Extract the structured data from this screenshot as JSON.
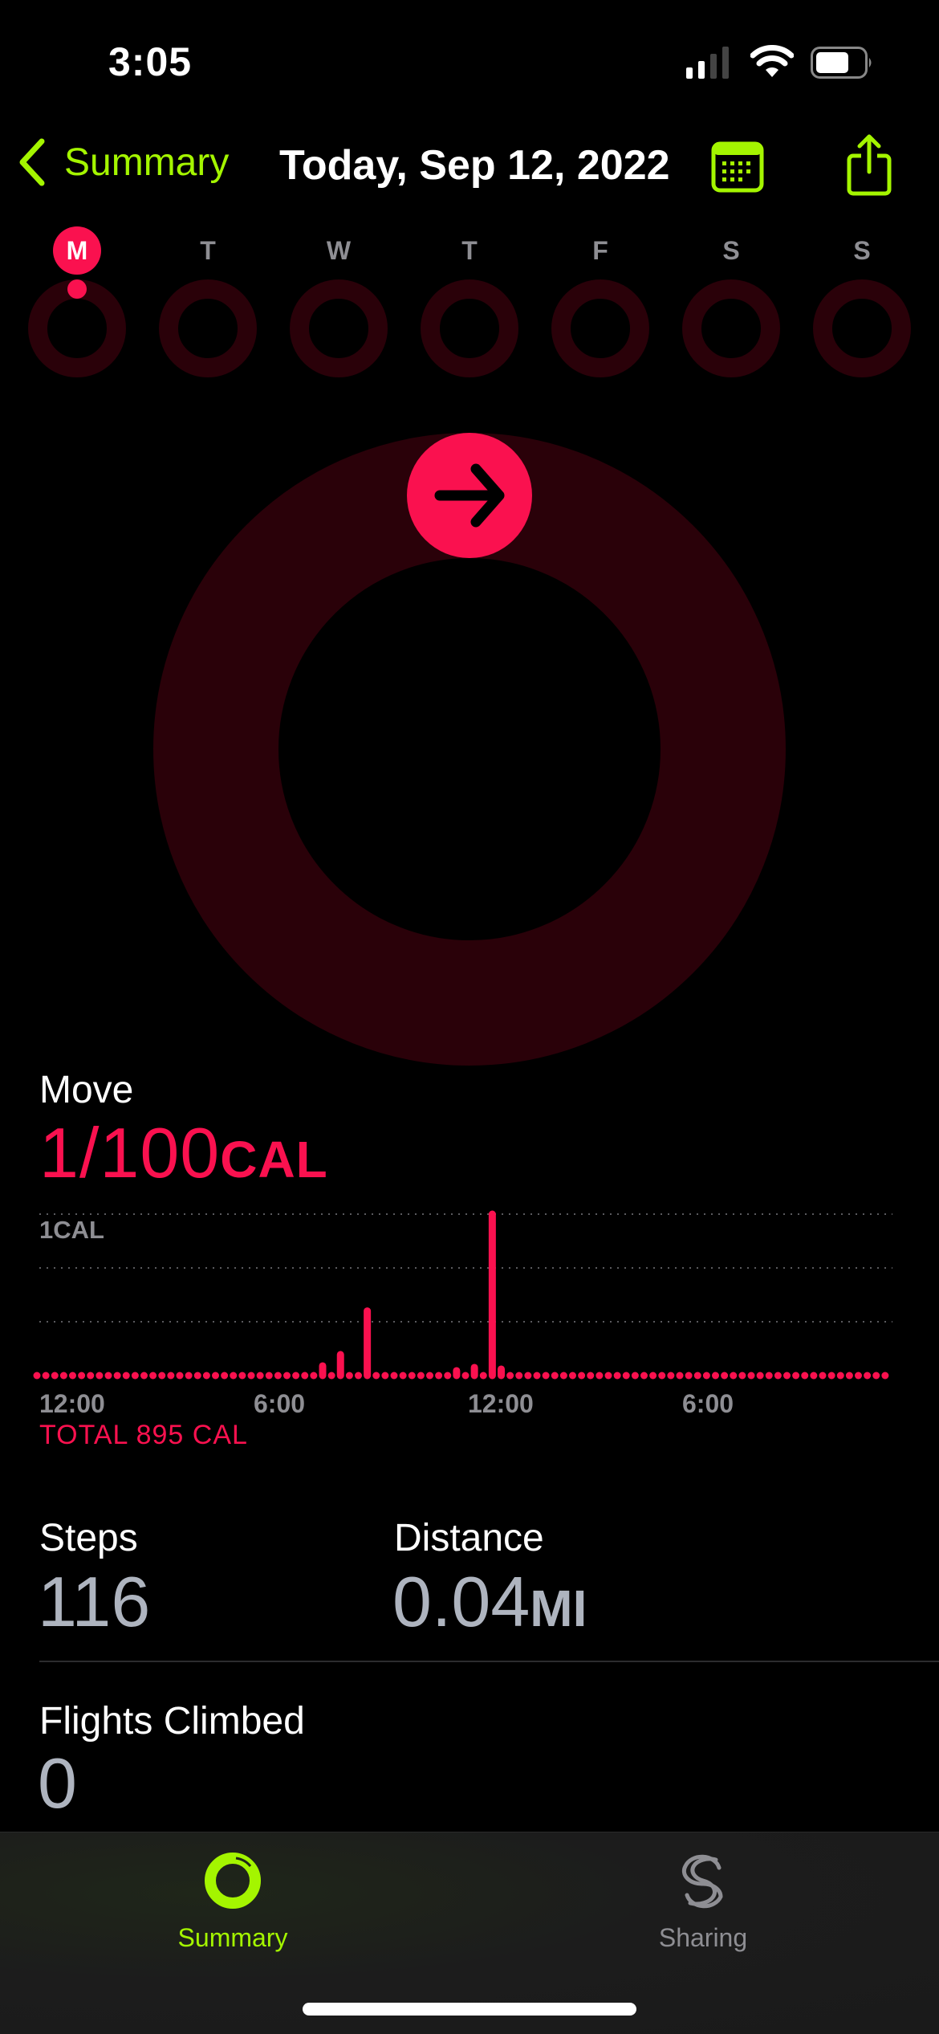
{
  "status_bar": {
    "time": "3:05",
    "signal_bars": 2,
    "signal_total": 4,
    "battery_percent": 70
  },
  "colors": {
    "accent": "#a4f500",
    "move": "#fa114f",
    "move_dim": "#2a0109",
    "secondary_text": "#8e8e93",
    "stat_value": "#aeb4bf"
  },
  "nav": {
    "back_label": "Summary",
    "title": "Today, Sep 12, 2022",
    "calendar_icon": "calendar-icon",
    "share_icon": "share-icon"
  },
  "week": {
    "days": [
      {
        "label": "M",
        "active": true,
        "progress": 0.01
      },
      {
        "label": "T",
        "active": false,
        "progress": 0
      },
      {
        "label": "W",
        "active": false,
        "progress": 0
      },
      {
        "label": "T",
        "active": false,
        "progress": 0
      },
      {
        "label": "F",
        "active": false,
        "progress": 0
      },
      {
        "label": "S",
        "active": false,
        "progress": 0
      },
      {
        "label": "S",
        "active": false,
        "progress": 0
      }
    ]
  },
  "ring": {
    "progress": 0.01,
    "icon": "arrow-right-icon"
  },
  "move": {
    "label": "Move",
    "value": "1/100",
    "unit": "CAL",
    "total": "TOTAL 895 CAL"
  },
  "chart_data": {
    "type": "bar",
    "title": "Move",
    "ylabel": "",
    "xlabel": "",
    "y_tick_label": "1CAL",
    "ylim": [
      0,
      1
    ],
    "grid": true,
    "bins": 96,
    "bin_minutes": 15,
    "x_tick_labels": [
      {
        "label": "12:00",
        "bin": 0
      },
      {
        "label": "6:00",
        "bin": 24
      },
      {
        "label": "12:00",
        "bin": 48
      },
      {
        "label": "6:00",
        "bin": 72
      }
    ],
    "nonzero": [
      {
        "bin": 32,
        "value": 0.06
      },
      {
        "bin": 34,
        "value": 0.13
      },
      {
        "bin": 37,
        "value": 0.4
      },
      {
        "bin": 47,
        "value": 0.03
      },
      {
        "bin": 49,
        "value": 0.05
      },
      {
        "bin": 51,
        "value": 1.0
      },
      {
        "bin": 52,
        "value": 0.04
      }
    ]
  },
  "stats": {
    "steps": {
      "label": "Steps",
      "value": "116"
    },
    "distance": {
      "label": "Distance",
      "value": "0.04",
      "unit": "MI"
    },
    "flights": {
      "label": "Flights Climbed",
      "value": "0"
    }
  },
  "tabs": [
    {
      "label": "Summary",
      "icon": "activity-ring-icon",
      "selected": true
    },
    {
      "label": "Sharing",
      "icon": "sharing-icon",
      "selected": false
    }
  ]
}
